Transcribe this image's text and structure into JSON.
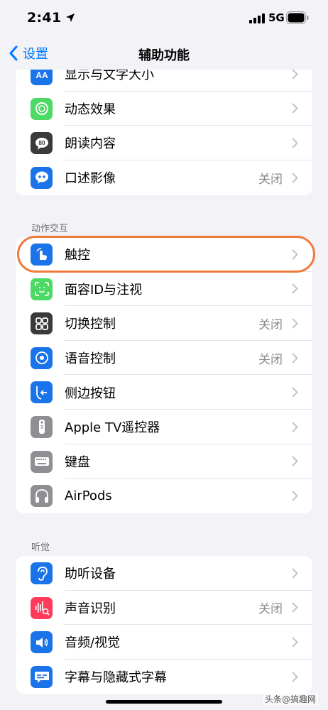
{
  "status": {
    "time": "2:41",
    "network": "5G"
  },
  "nav": {
    "back_label": "设置",
    "title": "辅助功能"
  },
  "group_top": [
    {
      "label": "显示与文字大小",
      "value": "",
      "icon": "text-size-icon",
      "color": "#1a73e8"
    },
    {
      "label": "动态效果",
      "value": "",
      "icon": "motion-icon",
      "color": "#4cd964"
    },
    {
      "label": "朗读内容",
      "value": "",
      "icon": "spoken-content-icon",
      "color": "#3a3a3c"
    },
    {
      "label": "口述影像",
      "value": "关闭",
      "icon": "audio-description-icon",
      "color": "#1a73e8"
    }
  ],
  "section_interaction": {
    "header": "动作交互",
    "items": [
      {
        "label": "触控",
        "value": "",
        "icon": "touch-icon",
        "color": "#1a73e8"
      },
      {
        "label": "面容ID与注视",
        "value": "",
        "icon": "face-id-icon",
        "color": "#4cd964"
      },
      {
        "label": "切换控制",
        "value": "关闭",
        "icon": "switch-control-icon",
        "color": "#3a3a3c"
      },
      {
        "label": "语音控制",
        "value": "关闭",
        "icon": "voice-control-icon",
        "color": "#1a73e8"
      },
      {
        "label": "侧边按钮",
        "value": "",
        "icon": "side-button-icon",
        "color": "#1a73e8"
      },
      {
        "label": "Apple TV遥控器",
        "value": "",
        "icon": "remote-icon",
        "color": "#8e8e93"
      },
      {
        "label": "键盘",
        "value": "",
        "icon": "keyboard-icon",
        "color": "#8e8e93"
      },
      {
        "label": "AirPods",
        "value": "",
        "icon": "airpods-icon",
        "color": "#8e8e93"
      }
    ]
  },
  "section_hearing": {
    "header": "听觉",
    "items": [
      {
        "label": "助听设备",
        "value": "",
        "icon": "hearing-devices-icon",
        "color": "#1a73e8"
      },
      {
        "label": "声音识别",
        "value": "关闭",
        "icon": "sound-recognition-icon",
        "color": "#ff3b5c"
      },
      {
        "label": "音频/视觉",
        "value": "",
        "icon": "audio-visual-icon",
        "color": "#1a73e8"
      },
      {
        "label": "字幕与隐藏式字幕",
        "value": "",
        "icon": "subtitles-icon",
        "color": "#1a73e8"
      }
    ]
  },
  "watermark": "头条@搞趣网"
}
